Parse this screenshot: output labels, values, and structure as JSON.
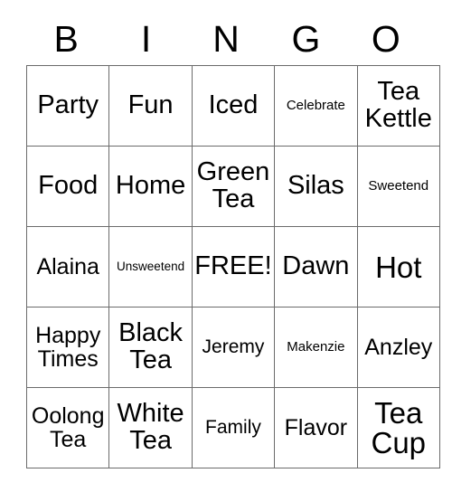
{
  "card": {
    "title_letters": [
      "B",
      "I",
      "N",
      "G",
      "O"
    ],
    "columns": 5,
    "rows": 5,
    "free_space_label": "FREE!",
    "border_color": "#6b6b6b",
    "text_color": "#000000",
    "background_color": "#ffffff",
    "cells": [
      [
        {
          "text": "Party",
          "size": "fs-xl"
        },
        {
          "text": "Fun",
          "size": "fs-xl"
        },
        {
          "text": "Iced",
          "size": "fs-xl"
        },
        {
          "text": "Celebrate",
          "size": "fs-sm"
        },
        {
          "text": "Tea\nKettle",
          "size": "fs-xl"
        }
      ],
      [
        {
          "text": "Food",
          "size": "fs-xl"
        },
        {
          "text": "Home",
          "size": "fs-xl"
        },
        {
          "text": "Green\nTea",
          "size": "fs-xl"
        },
        {
          "text": "Silas",
          "size": "fs-xl"
        },
        {
          "text": "Sweetend",
          "size": "fs-sm"
        }
      ],
      [
        {
          "text": "Alaina",
          "size": "fs-lg"
        },
        {
          "text": "Unsweetend",
          "size": "fs-xs"
        },
        {
          "text": "FREE!",
          "size": "fs-xl"
        },
        {
          "text": "Dawn",
          "size": "fs-xl"
        },
        {
          "text": "Hot",
          "size": "fs-xxl"
        }
      ],
      [
        {
          "text": "Happy\nTimes",
          "size": "fs-lg"
        },
        {
          "text": "Black\nTea",
          "size": "fs-xl"
        },
        {
          "text": "Jeremy",
          "size": "fs-md"
        },
        {
          "text": "Makenzie",
          "size": "fs-sm"
        },
        {
          "text": "Anzley",
          "size": "fs-lg"
        }
      ],
      [
        {
          "text": "Oolong\nTea",
          "size": "fs-lg"
        },
        {
          "text": "White\nTea",
          "size": "fs-xl"
        },
        {
          "text": "Family",
          "size": "fs-md"
        },
        {
          "text": "Flavor",
          "size": "fs-lg"
        },
        {
          "text": "Tea\nCup",
          "size": "fs-xxl"
        }
      ]
    ]
  }
}
